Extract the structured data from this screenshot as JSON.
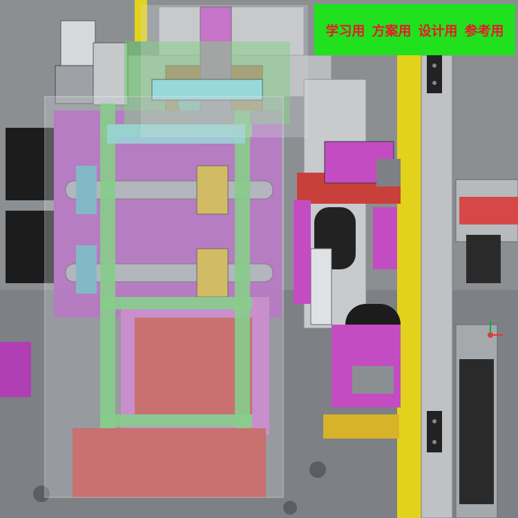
{
  "banner": {
    "labels": [
      "学习用",
      "方案用",
      "设计用",
      "参考用"
    ],
    "background": "#21e11e",
    "text_color": "#e8182b"
  },
  "viewport": {
    "toolbar_icons": [
      "view-tool-icon",
      "view-tool-icon",
      "view-tool-icon",
      "view-tool-icon",
      "view-tool-icon",
      "view-tool-icon"
    ]
  },
  "colors": {
    "frame_green": "#66cc66",
    "magenta": "#c34cc3",
    "rail_yellow": "#e3d21c",
    "cyan_plate": "#7fdcdc",
    "red_base": "#c9403b",
    "motor_black": "#1c1c1c",
    "guard_glass": "#c8ccd2"
  }
}
